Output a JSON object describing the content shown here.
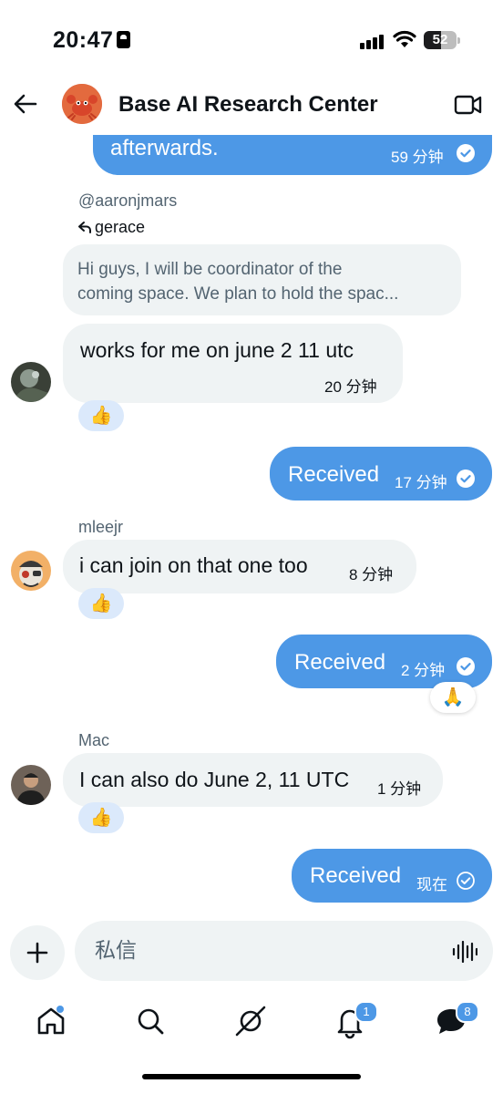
{
  "status_bar": {
    "time": "20:47",
    "battery": "52",
    "battery_level": 0.52
  },
  "header": {
    "title": "Base AI Research Center",
    "avatar_icon": "crab-icon",
    "video_icon": "video-camera-icon"
  },
  "messages": [
    {
      "id": "m0",
      "direction": "out",
      "text": "afterwards.",
      "time": "59 分钟",
      "status": "read"
    },
    {
      "id": "m1",
      "direction": "in",
      "sender": "@aaronjmars",
      "reply_to": "gerace",
      "quote_lines": [
        "Hi guys, I will be coordinator of the",
        "coming space. We plan to hold the spac..."
      ],
      "text": "works for me on june 2 11 utc",
      "time": "20 分钟",
      "reaction": "👍"
    },
    {
      "id": "m2",
      "direction": "out",
      "text": "Received",
      "time": "17 分钟",
      "status": "read"
    },
    {
      "id": "m3",
      "direction": "in",
      "sender": "mleejr",
      "text": "i can join on that one too",
      "time": "8 分钟",
      "reaction": "👍"
    },
    {
      "id": "m4",
      "direction": "out",
      "text": "Received",
      "time": "2 分钟",
      "status": "read",
      "reaction": "🙏"
    },
    {
      "id": "m5",
      "direction": "in",
      "sender": "Mac",
      "text": "I can also do June 2, 11 UTC",
      "time": "1 分钟",
      "reaction": "👍"
    },
    {
      "id": "m6",
      "direction": "out",
      "text": "Received",
      "time": "现在",
      "status": "sent"
    }
  ],
  "composer": {
    "placeholder": "私信",
    "add_icon": "plus-icon",
    "voice_icon": "voice-waveform-icon"
  },
  "tabbar": {
    "tabs": [
      {
        "name": "home",
        "icon": "home-icon",
        "badge": "",
        "dot": true
      },
      {
        "name": "search",
        "icon": "search-icon",
        "badge": ""
      },
      {
        "name": "grok",
        "icon": "grok-icon",
        "badge": ""
      },
      {
        "name": "notifications",
        "icon": "bell-icon",
        "badge": "1"
      },
      {
        "name": "messages",
        "icon": "messages-icon",
        "badge": "8"
      }
    ]
  },
  "colors": {
    "accent": "#4d98e6",
    "bubble_in": "#eff3f4",
    "muted": "#536471"
  }
}
